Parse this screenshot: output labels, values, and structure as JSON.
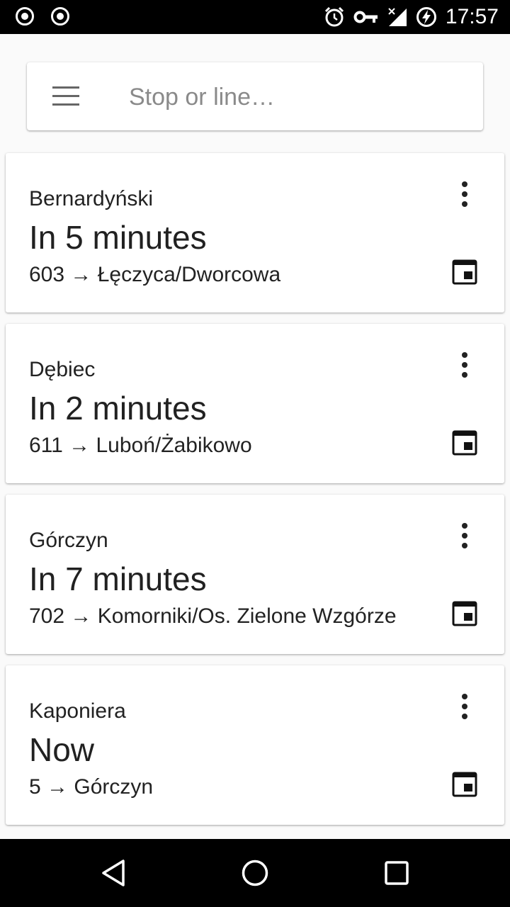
{
  "status_bar": {
    "time": "17:57",
    "left_icons": [
      "record-icon",
      "record-icon"
    ],
    "right_icons": [
      "alarm-icon",
      "vpn-key-icon",
      "signal-no-data-icon",
      "battery-charging-icon"
    ]
  },
  "search": {
    "placeholder": "Stop or line…",
    "value": ""
  },
  "departures": [
    {
      "stop": "Bernardyński",
      "eta": "In 5 minutes",
      "route": "603 → Łęczyca/Dworcowa"
    },
    {
      "stop": "Dębiec",
      "eta": "In 2 minutes",
      "route": "611 → Luboń/Żabikowo"
    },
    {
      "stop": "Górczyn",
      "eta": "In 7 minutes",
      "route": "702 → Komorniki/Os. Zielone Wzgórze"
    },
    {
      "stop": "Kaponiera",
      "eta": "Now",
      "route": "5 → Górczyn"
    }
  ],
  "nav_bar": {
    "buttons": [
      "back-icon",
      "home-icon",
      "recents-icon"
    ]
  },
  "colors": {
    "background": "#fafafa",
    "card": "#ffffff",
    "text": "#212121",
    "placeholder": "#8a8a8a",
    "bars": "#000000"
  }
}
